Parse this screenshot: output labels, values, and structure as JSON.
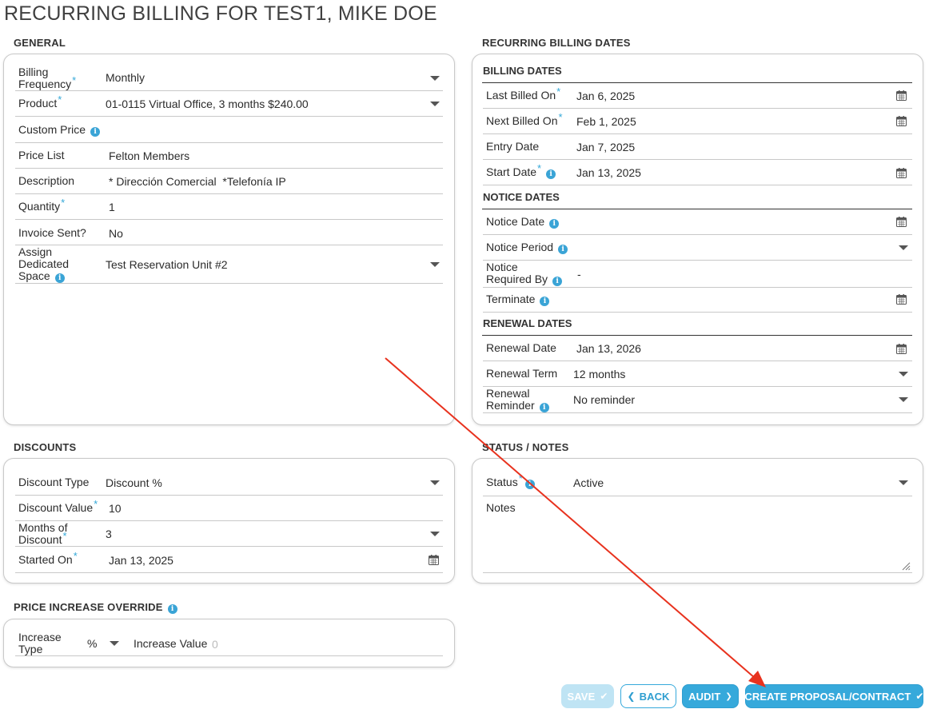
{
  "page": {
    "title": "RECURRING BILLING FOR TEST1, MIKE DOE"
  },
  "general": {
    "section_title": "GENERAL",
    "billing_frequency": {
      "label_1": "Billing",
      "label_2": "Frequency",
      "value": "Monthly"
    },
    "product": {
      "label": "Product",
      "value": "01-0115 Virtual Office, 3 months $240.00"
    },
    "custom_price": {
      "label": "Custom Price",
      "value": ""
    },
    "price_list": {
      "label": "Price List",
      "value": "Felton Members"
    },
    "description": {
      "label": "Description",
      "value": "* Dirección Comercial  *Telefonía IP"
    },
    "quantity": {
      "label": "Quantity",
      "value": "1"
    },
    "invoice_sent": {
      "label": "Invoice Sent?",
      "value": "No"
    },
    "dedicated_space": {
      "label_1": "Assign",
      "label_2": "Dedicated",
      "label_3": "Space",
      "value": "Test Reservation Unit #2"
    }
  },
  "billing_dates_section": {
    "section_title": "RECURRING BILLING DATES",
    "billing_dates_heading": "BILLING DATES",
    "last_billed_on": {
      "label": "Last Billed On",
      "value": "Jan 6, 2025"
    },
    "next_billed_on": {
      "label": "Next Billed On",
      "value": "Feb 1, 2025"
    },
    "entry_date": {
      "label": "Entry Date",
      "value": "Jan 7, 2025"
    },
    "start_date": {
      "label": "Start Date",
      "value": "Jan 13, 2025"
    },
    "notice_dates_heading": "NOTICE DATES",
    "notice_date": {
      "label": "Notice Date",
      "value": ""
    },
    "notice_period": {
      "label": "Notice Period",
      "value": ""
    },
    "notice_required_by": {
      "label_1": "Notice",
      "label_2": "Required By",
      "value": "-"
    },
    "terminate": {
      "label": "Terminate",
      "value": ""
    },
    "renewal_dates_heading": "RENEWAL DATES",
    "renewal_date": {
      "label": "Renewal Date",
      "value": "Jan 13, 2026"
    },
    "renewal_term": {
      "label": "Renewal Term",
      "value": "12 months"
    },
    "renewal_reminder": {
      "label_1": "Renewal",
      "label_2": "Reminder",
      "value": "No reminder"
    }
  },
  "discounts": {
    "section_title": "DISCOUNTS",
    "discount_type": {
      "label": "Discount Type",
      "value": "Discount %"
    },
    "discount_value": {
      "label": "Discount Value",
      "value": "10"
    },
    "months_of_discount": {
      "label_1": "Months of",
      "label_2": "Discount",
      "value": "3"
    },
    "started_on": {
      "label": "Started On",
      "value": "Jan 13, 2025"
    }
  },
  "status_notes": {
    "section_title": "STATUS / NOTES",
    "status": {
      "label": "Status",
      "value": "Active"
    },
    "notes": {
      "label": "Notes",
      "value": ""
    }
  },
  "price_increase": {
    "section_title": "PRICE INCREASE OVERRIDE",
    "increase_type": {
      "label_1": "Increase",
      "label_2": "Type",
      "value": "%"
    },
    "increase_value": {
      "label": "Increase Value",
      "placeholder": "0"
    }
  },
  "actions": {
    "save": "SAVE",
    "back": "BACK",
    "audit": "AUDIT",
    "create": "CREATE PROPOSAL/CONTRACT"
  },
  "icons": {
    "required_marker": "asterisk-icon",
    "info": "info-icon",
    "dropdown": "caret-down-icon",
    "calendar": "calendar-icon",
    "check": "check-icon",
    "chevron_left": "chevron-left-icon",
    "chevron_right": "chevron-right-icon",
    "annotation": "red-arrow-annotation"
  },
  "colors": {
    "accent": "#36a9db",
    "required": "#34a8d8",
    "annotation_arrow": "#e8321e"
  }
}
